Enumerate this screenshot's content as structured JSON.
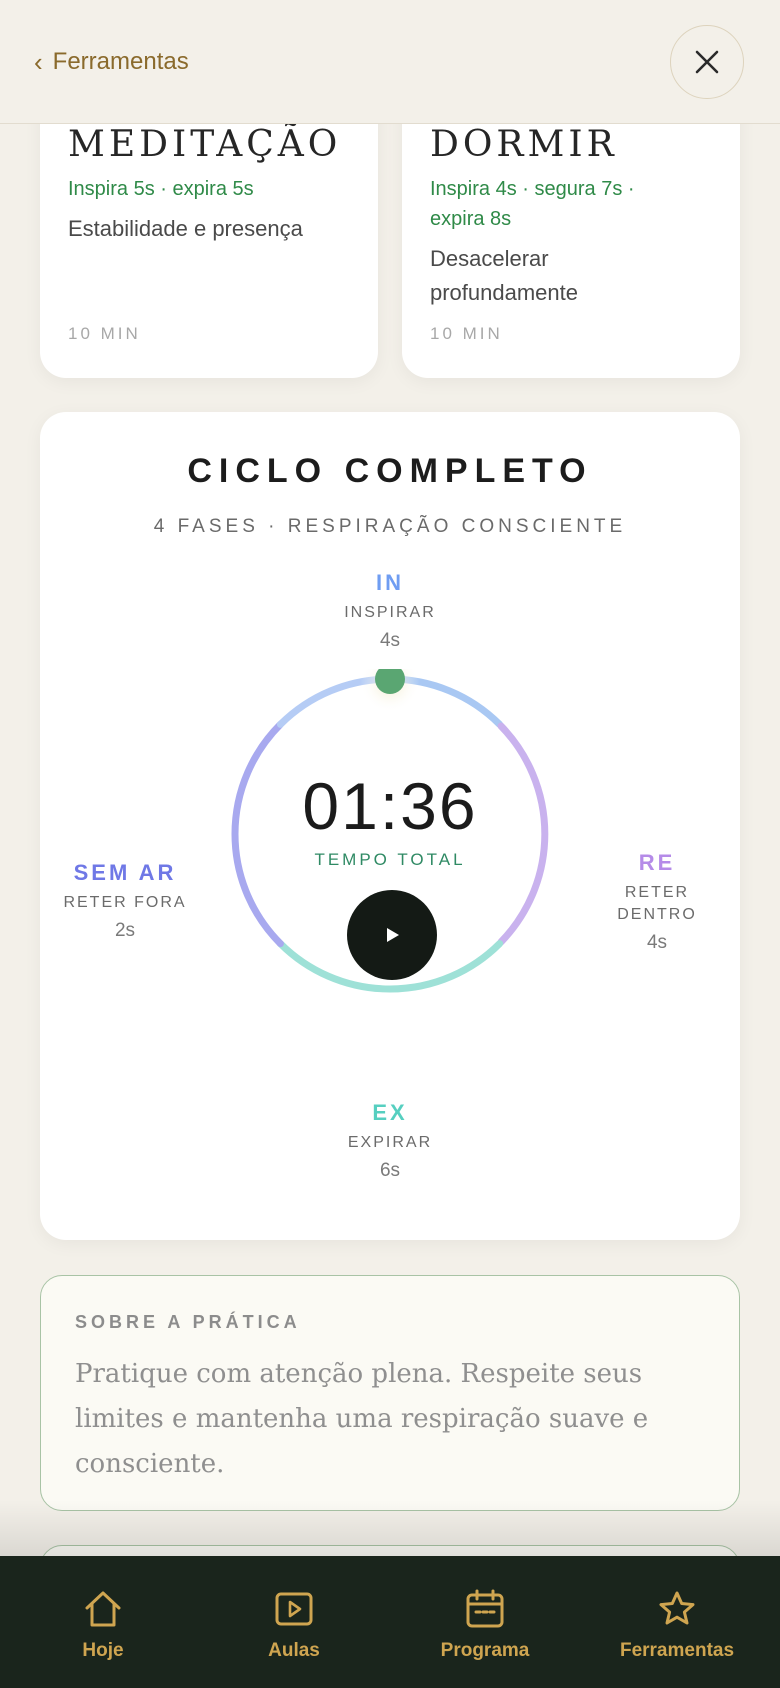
{
  "header": {
    "back_label": "Ferramentas"
  },
  "cards": [
    {
      "title": "MEDITAÇÃO",
      "rate_lines": [
        "Inspira 5s · expira 5s"
      ],
      "desc_lines": [
        "Estabilidade e presença"
      ],
      "duration": "10 MIN"
    },
    {
      "title": "DORMIR",
      "rate_lines": [
        "Inspira 4s · segura 7s ·",
        "expira 8s"
      ],
      "desc_lines": [
        "Desacelerar",
        "profundamente"
      ],
      "duration": "10 MIN"
    }
  ],
  "ciclo": {
    "title": "CICLO COMPLETO",
    "subtitle": "4 FASES · RESPIRAÇÃO CONSCIENTE",
    "timer": "01:36",
    "timer_label": "TEMPO TOTAL",
    "phases": {
      "in": {
        "code": "IN",
        "name": "INSPIRAR",
        "duration": "4s",
        "color": "#6f9df2"
      },
      "re": {
        "code": "RE",
        "name_lines": [
          "RETER",
          "DENTRO"
        ],
        "duration": "4s",
        "color": "#b58be8"
      },
      "ex": {
        "code": "EX",
        "name": "EXPIRAR",
        "duration": "6s",
        "color": "#56cfc0"
      },
      "sem_ar": {
        "code": "SEM AR",
        "name": "RETER FORA",
        "duration": "2s",
        "color": "#6f78e6"
      }
    }
  },
  "about": {
    "title": "SOBRE A PRÁTICA",
    "text": "Pratique com atenção plena. Respeite seus limites e mantenha uma respiração suave e consciente."
  },
  "nav": {
    "items": [
      {
        "label": "Hoje",
        "icon": "home-icon"
      },
      {
        "label": "Aulas",
        "icon": "play-square-icon"
      },
      {
        "label": "Programa",
        "icon": "calendar-icon"
      },
      {
        "label": "Ferramentas",
        "icon": "star-icon"
      }
    ],
    "color": "#cfa550",
    "background": "#1a251c"
  }
}
